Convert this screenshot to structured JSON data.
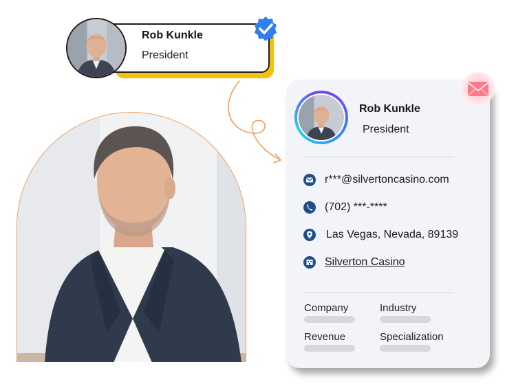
{
  "mini_card": {
    "name": "Rob Kunkle",
    "title": "President",
    "verified_icon": "verified-check-icon",
    "accent_color": "#f4c20d"
  },
  "contact_card": {
    "name": "Rob Kunkle",
    "title": "President",
    "email": "r***@silvertoncasino.com",
    "phone": "(702) ***-****",
    "location": "Las Vegas, Nevada, 89139",
    "company_link": "Silverton Casino",
    "fields": [
      {
        "label": "Company"
      },
      {
        "label": "Industry"
      },
      {
        "label": "Revenue"
      },
      {
        "label": "Specialization"
      }
    ],
    "icon_color": "#1e4e8c",
    "icons": {
      "email": "envelope-icon",
      "phone": "phone-icon",
      "location": "map-pin-icon",
      "company": "building-icon",
      "mail_bubble": "mail-icon"
    }
  },
  "photo": {
    "border_color": "#f29a55"
  }
}
